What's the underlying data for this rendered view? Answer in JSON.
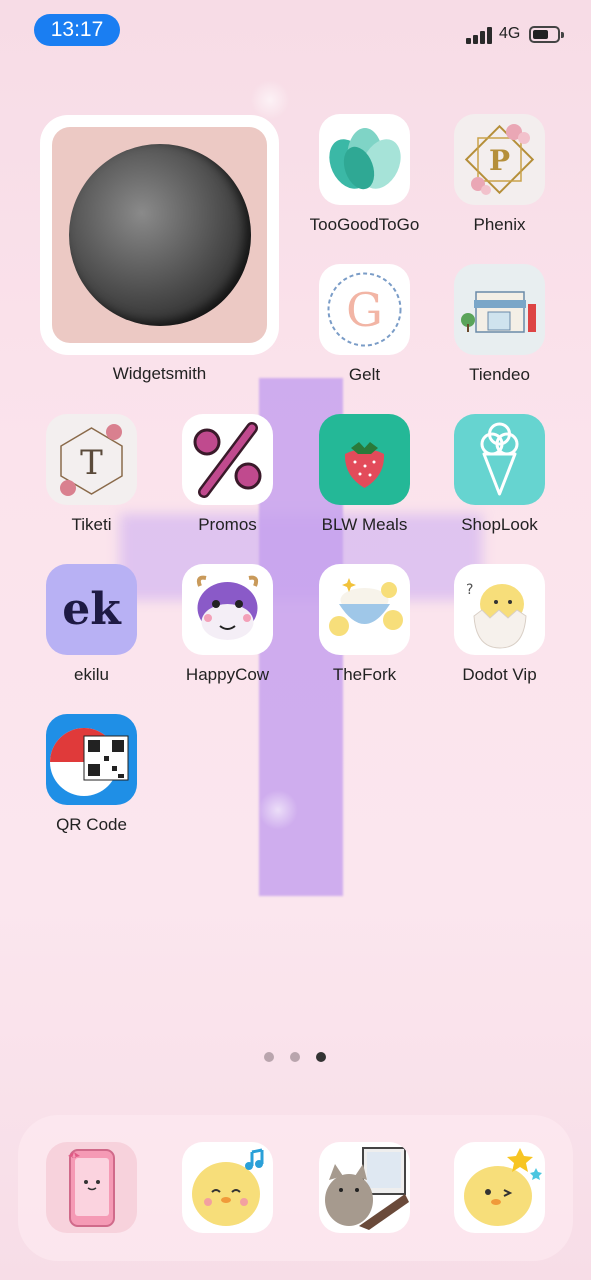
{
  "status_bar": {
    "time": "13:17",
    "network": "4G",
    "battery_percent": 55
  },
  "widget": {
    "label": "Widgetsmith",
    "icon": "moon-photo"
  },
  "apps": [
    {
      "id": "toogoodtogo",
      "label": "TooGoodToGo",
      "icon": "teal-leaves-icon"
    },
    {
      "id": "phenix",
      "label": "Phenix",
      "icon": "floral-p-monogram-icon"
    },
    {
      "id": "gelt",
      "label": "Gelt",
      "icon": "ornate-g-icon"
    },
    {
      "id": "tiendeo",
      "label": "Tiendeo",
      "icon": "storefront-icon"
    },
    {
      "id": "tiketi",
      "label": "Tiketi",
      "icon": "floral-t-monogram-icon"
    },
    {
      "id": "promos",
      "label": "Promos",
      "icon": "percent-icon"
    },
    {
      "id": "blw-meals",
      "label": "BLW Meals",
      "icon": "strawberry-icon"
    },
    {
      "id": "shoplook",
      "label": "ShopLook",
      "icon": "ice-cream-cone-icon"
    },
    {
      "id": "ekilu",
      "label": "ekilu",
      "icon": "ek-logo",
      "logo_text": "ek"
    },
    {
      "id": "happycow",
      "label": "HappyCow",
      "icon": "cow-face-icon"
    },
    {
      "id": "thefork",
      "label": "TheFork",
      "icon": "chick-rice-bowl-icon"
    },
    {
      "id": "dodot-vip",
      "label": "Dodot Vip",
      "icon": "chick-egg-icon"
    },
    {
      "id": "qr-code",
      "label": "QR Code",
      "icon": "pokeball-qr-icon"
    }
  ],
  "page_dots": {
    "count": 3,
    "active_index": 2
  },
  "dock": [
    {
      "id": "dock-phone",
      "icon": "pink-phone-icon"
    },
    {
      "id": "dock-chick-music",
      "icon": "chick-music-icon"
    },
    {
      "id": "dock-pusheen-laptop",
      "icon": "cat-laptop-icon"
    },
    {
      "id": "dock-chick-star",
      "icon": "chick-star-icon"
    }
  ],
  "colors": {
    "time_pill": "#1a7ef2",
    "wallpaper": "#fbe3ec",
    "cross": "#c4a0ee"
  }
}
